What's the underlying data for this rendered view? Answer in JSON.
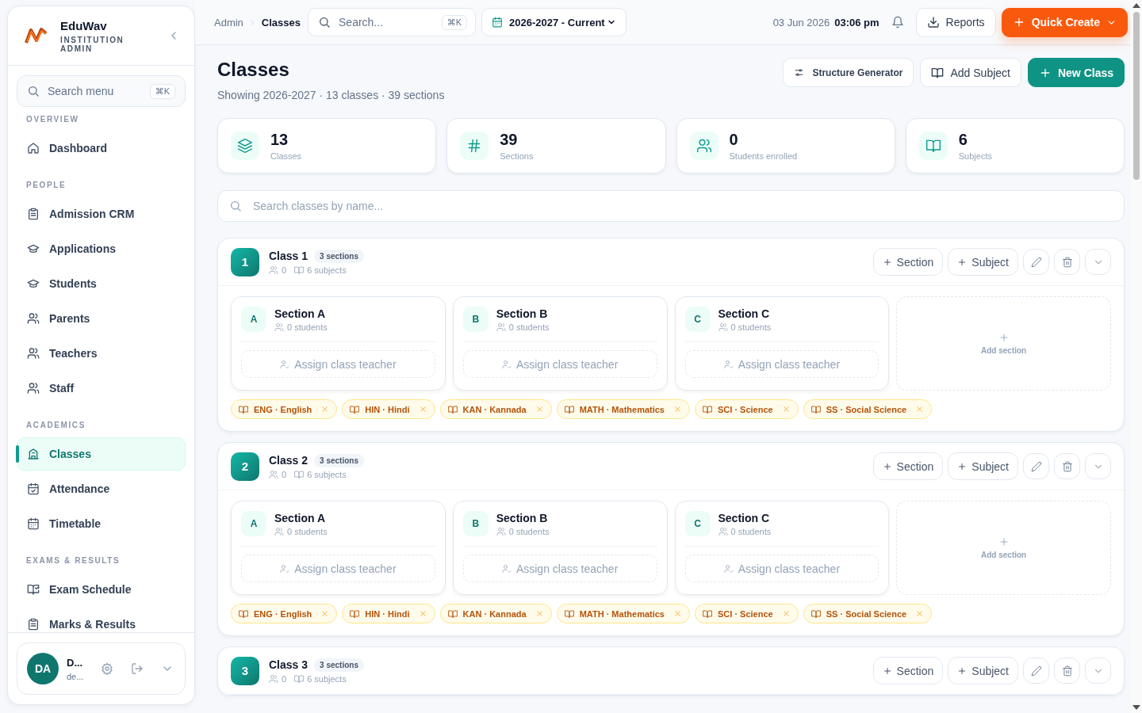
{
  "sidebar": {
    "brand": "EduWav",
    "subtitle": "INSTITUTION ADMIN",
    "search": {
      "placeholder": "Search menu",
      "shortcut": "⌘K"
    },
    "groups": [
      {
        "label": "OVERVIEW",
        "items": [
          {
            "label": "Dashboard",
            "selected": false
          }
        ]
      },
      {
        "label": "PEOPLE",
        "items": [
          {
            "label": "Admission CRM",
            "selected": false
          },
          {
            "label": "Applications",
            "selected": false
          },
          {
            "label": "Students",
            "selected": false
          },
          {
            "label": "Parents",
            "selected": false
          },
          {
            "label": "Teachers",
            "selected": false
          },
          {
            "label": "Staff",
            "selected": false
          }
        ]
      },
      {
        "label": "ACADEMICS",
        "items": [
          {
            "label": "Classes",
            "selected": true
          },
          {
            "label": "Attendance",
            "selected": false
          },
          {
            "label": "Timetable",
            "selected": false
          }
        ]
      },
      {
        "label": "EXAMS & RESULTS",
        "items": [
          {
            "label": "Exam Schedule",
            "selected": false
          },
          {
            "label": "Marks & Results",
            "selected": false
          }
        ]
      }
    ],
    "user": {
      "initials": "DA",
      "name": "D...",
      "email": "de..."
    }
  },
  "topbar": {
    "breadcrumb": [
      "Admin",
      "Classes"
    ],
    "search": {
      "placeholder": "Search...",
      "shortcut": "⌘K"
    },
    "year": "2026-2027 - Current",
    "date": "03 Jun 2026",
    "time": "03:06 pm",
    "reports": "Reports",
    "quick_create": "Quick Create"
  },
  "page": {
    "title": "Classes",
    "subtitle": "Showing 2026-2027 · 13 classes · 39 sections",
    "actions": [
      "Structure Generator",
      "Add Subject",
      "New Class"
    ]
  },
  "stats": [
    {
      "value": "13",
      "label": "Classes"
    },
    {
      "value": "39",
      "label": "Sections"
    },
    {
      "value": "0",
      "label": "Students enrolled"
    },
    {
      "value": "6",
      "label": "Subjects"
    }
  ],
  "class_search": {
    "placeholder": "Search classes by name..."
  },
  "classes": [
    {
      "number": "1",
      "name": "Class 1",
      "badge": "3 sections",
      "students": "0",
      "subjects": "6 subjects",
      "buttons": [
        "Section",
        "Subject"
      ],
      "sections": [
        {
          "letter": "A",
          "name": "Section A",
          "students": "0 students",
          "assign": "Assign class teacher"
        },
        {
          "letter": "B",
          "name": "Section B",
          "students": "0 students",
          "assign": "Assign class teacher"
        },
        {
          "letter": "C",
          "name": "Section C",
          "students": "0 students",
          "assign": "Assign class teacher"
        }
      ],
      "add_section": "Add section",
      "tags": [
        "ENG · English",
        "HIN · Hindi",
        "KAN · Kannada",
        "MATH · Mathematics",
        "SCI · Science",
        "SS · Social Science"
      ]
    },
    {
      "number": "2",
      "name": "Class 2",
      "badge": "3 sections",
      "students": "0",
      "subjects": "6 subjects",
      "buttons": [
        "Section",
        "Subject"
      ],
      "sections": [
        {
          "letter": "A",
          "name": "Section A",
          "students": "0 students",
          "assign": "Assign class teacher"
        },
        {
          "letter": "B",
          "name": "Section B",
          "students": "0 students",
          "assign": "Assign class teacher"
        },
        {
          "letter": "C",
          "name": "Section C",
          "students": "0 students",
          "assign": "Assign class teacher"
        }
      ],
      "add_section": "Add section",
      "tags": [
        "ENG · English",
        "HIN · Hindi",
        "KAN · Kannada",
        "MATH · Mathematics",
        "SCI · Science",
        "SS · Social Science"
      ]
    },
    {
      "number": "3",
      "name": "Class 3",
      "badge": "3 sections",
      "students": "0",
      "subjects": "6 subjects",
      "buttons": [
        "Section",
        "Subject"
      ]
    }
  ]
}
